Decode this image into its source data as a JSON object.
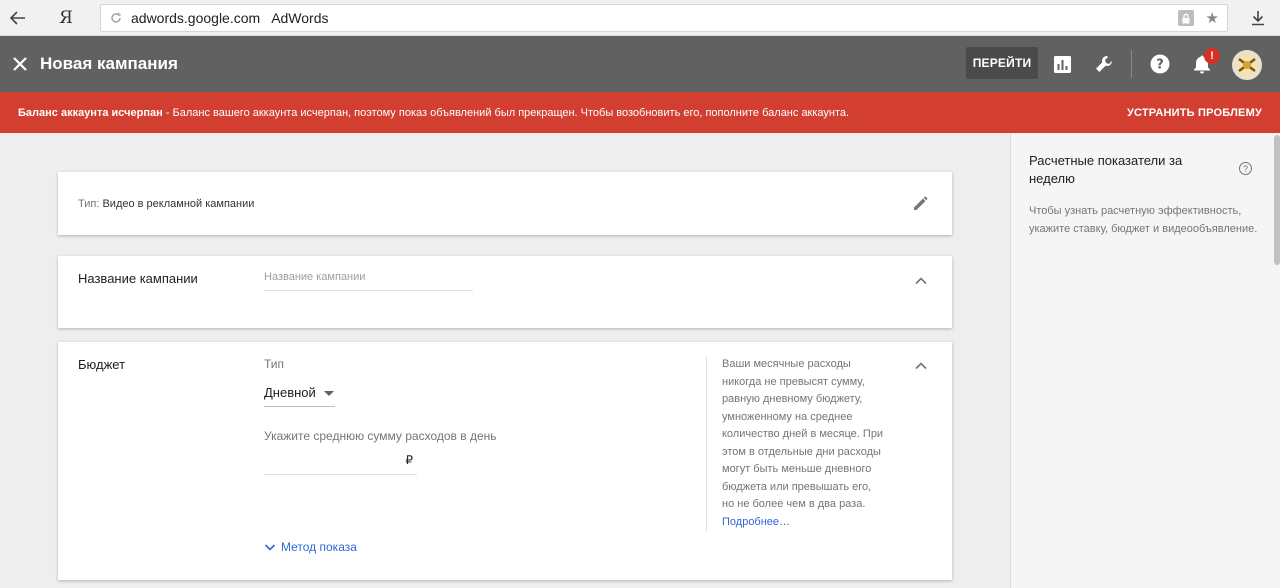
{
  "browser": {
    "url_domain": "adwords.google.com",
    "page_title": "AdWords",
    "yandex_label": "Я"
  },
  "app_bar": {
    "title": "Новая кампания",
    "go_button": "ПЕРЕЙТИ",
    "notification_count": "!"
  },
  "alert": {
    "strong_text": "Баланс аккаунта исчерпан",
    "message": " - Баланс вашего аккаунта исчерпан, поэтому показ объявлений был прекращен. Чтобы возобновить его, пополните баланс аккаунта.",
    "action": "УСТРАНИТЬ ПРОБЛЕМУ",
    "color": "#d23f31"
  },
  "type_card": {
    "label": "Тип:",
    "value": " Видео в рекламной кампании"
  },
  "name_card": {
    "title": "Название кампании",
    "placeholder": "Название кампании"
  },
  "budget_card": {
    "title": "Бюджет",
    "type_label": "Тип",
    "type_value": "Дневной",
    "amount_label": "Укажите среднюю сумму расходов в день",
    "currency": "₽",
    "help_text": "Ваши месячные расходы никогда не превысят сумму, равную дневному бюджету, умноженному на среднее количество дней в месяце. При этом в отдельные дни расходы могут быть меньше дневного бюджета или превышать его, но не более чем в два раза.",
    "help_link": "Подробнее…",
    "method_link": "Метод показа"
  },
  "side_panel": {
    "title": "Расчетные показатели за неделю",
    "description": "Чтобы узнать расчетную эффективность, укажите ставку, бюджет и видеообъявление.",
    "help_icon": "?"
  }
}
